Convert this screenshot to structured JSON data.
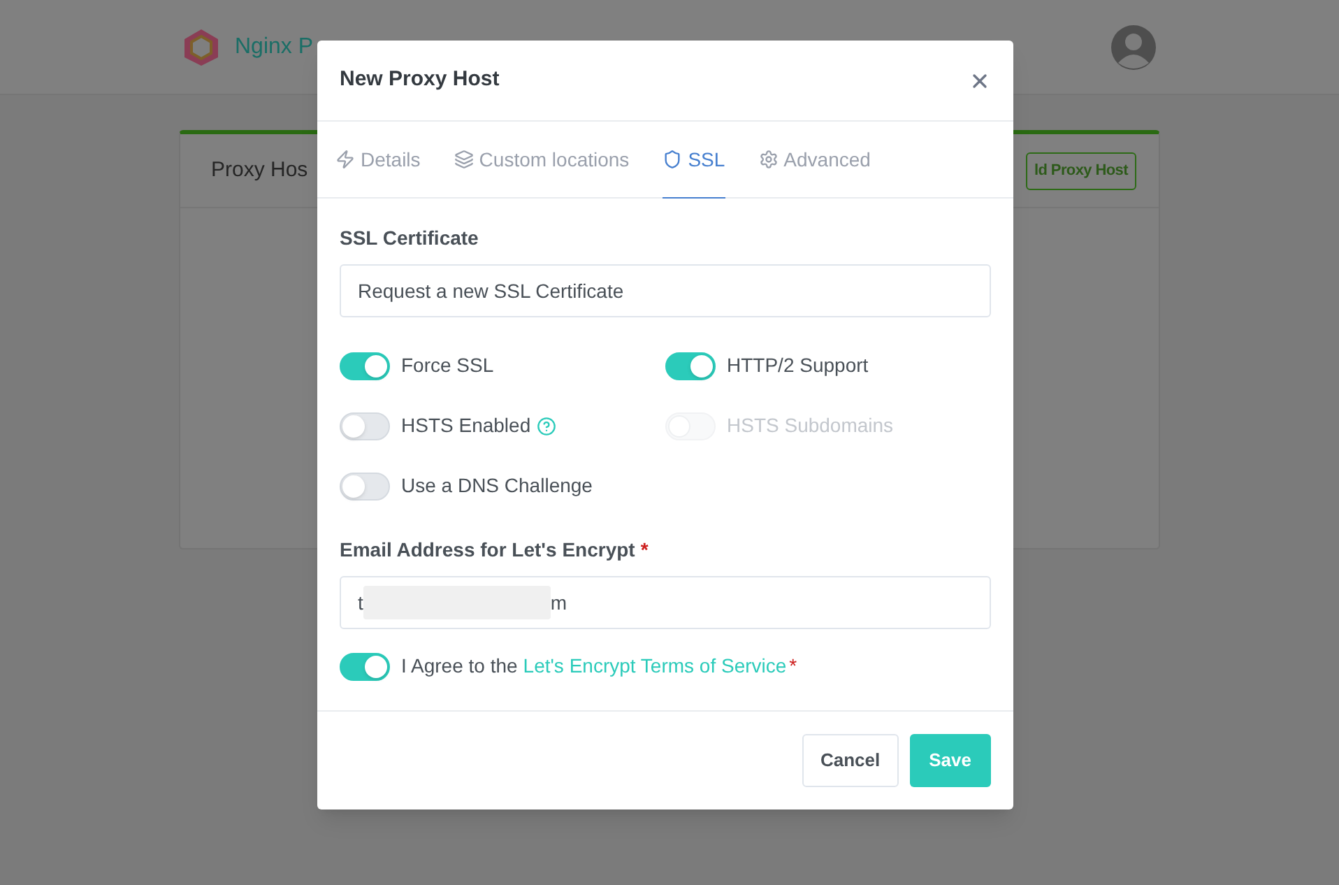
{
  "app_header": {
    "title": "Nginx P"
  },
  "card": {
    "title": "Proxy Hos",
    "button": "ld Proxy Host"
  },
  "modal": {
    "title": "New Proxy Host",
    "tabs": [
      {
        "label": "Details",
        "selected": false
      },
      {
        "label": "Custom locations",
        "selected": false
      },
      {
        "label": "SSL",
        "selected": true
      },
      {
        "label": "Advanced",
        "selected": false
      }
    ],
    "ssl_certificate": {
      "label": "SSL Certificate",
      "value": "Request a new SSL Certificate"
    },
    "switches": [
      {
        "label": "Force SSL",
        "on": true,
        "disabled": false,
        "help": false
      },
      {
        "label": "HTTP/2 Support",
        "on": true,
        "disabled": false,
        "help": false
      },
      {
        "label": "HSTS Enabled",
        "on": false,
        "disabled": false,
        "help": true
      },
      {
        "label": "HSTS Subdomains",
        "on": false,
        "disabled": true,
        "help": false
      },
      {
        "label": "Use a DNS Challenge",
        "on": false,
        "disabled": false,
        "help": false
      }
    ],
    "email": {
      "label": "Email Address for Let's Encrypt",
      "required_mark": "*",
      "value_start": "t",
      "value_end": "m"
    },
    "agree": {
      "on": true,
      "text": "I Agree to the",
      "link": "Let's Encrypt Terms of Service",
      "required_mark": "*"
    },
    "buttons": [
      {
        "label": "Cancel",
        "kind": "secondary"
      },
      {
        "label": "Save",
        "kind": "primary"
      }
    ]
  }
}
